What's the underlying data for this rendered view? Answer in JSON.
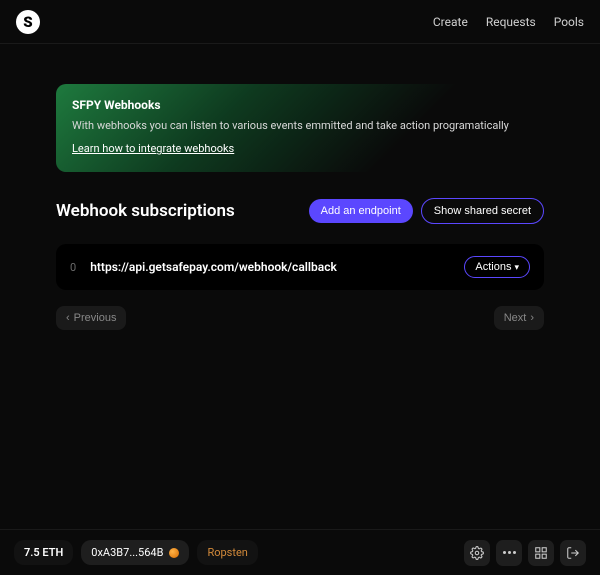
{
  "header": {
    "logo_letter": "S",
    "nav": [
      "Create",
      "Requests",
      "Pools"
    ]
  },
  "banner": {
    "title": "SFPY Webhooks",
    "description": "With webhooks you can listen to various events emmitted and take action programatically",
    "link_label": "Learn how to integrate webhooks"
  },
  "section": {
    "title": "Webhook subscriptions",
    "add_label": "Add an endpoint",
    "show_secret_label": "Show shared secret"
  },
  "rows": [
    {
      "index": "0",
      "url": "https://api.getsafepay.com/webhook/callback",
      "actions_label": "Actions"
    }
  ],
  "pager": {
    "prev": "Previous",
    "next": "Next"
  },
  "footer": {
    "balance": "7.5 ETH",
    "address": "0xA3B7...564B",
    "network": "Ropsten"
  }
}
